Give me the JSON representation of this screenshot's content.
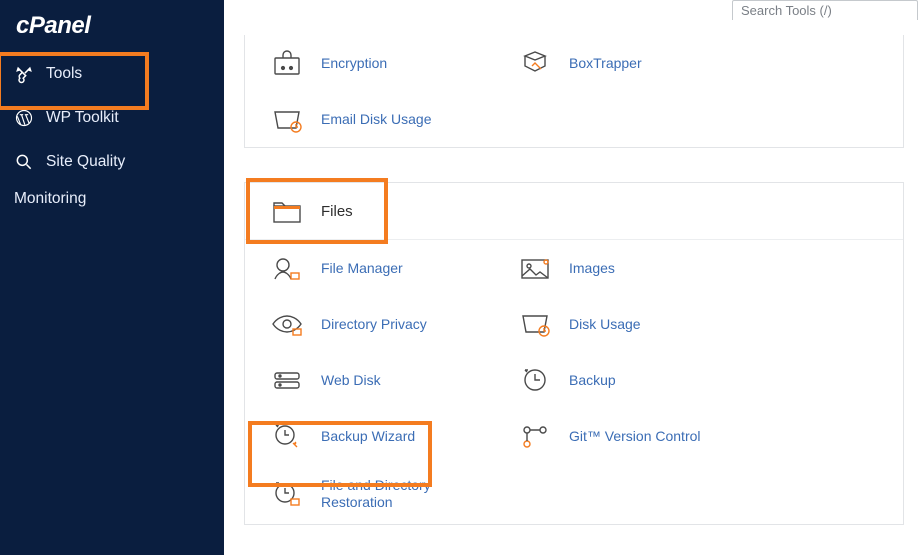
{
  "brand": {
    "name": "cPanel"
  },
  "search": {
    "placeholder": "Search Tools (/)"
  },
  "sidebar": {
    "items": [
      {
        "label": "Tools",
        "icon": "tools-icon"
      },
      {
        "label": "WP Toolkit",
        "icon": "wordpress-icon"
      },
      {
        "label": "Site Quality",
        "icon": "magnify-icon"
      },
      {
        "label": "Monitoring",
        "icon": ""
      }
    ]
  },
  "section_email": {
    "items": [
      {
        "label": "Encryption",
        "icon": "encryption-icon"
      },
      {
        "label": "BoxTrapper",
        "icon": "boxtrapper-icon"
      },
      {
        "label": "Email Disk Usage",
        "icon": "disk-clock-icon"
      }
    ]
  },
  "section_files": {
    "heading": "Files",
    "items": [
      {
        "label": "File Manager",
        "icon": "file-manager-icon"
      },
      {
        "label": "Images",
        "icon": "images-icon"
      },
      {
        "label": "Directory Privacy",
        "icon": "directory-privacy-icon"
      },
      {
        "label": "Disk Usage",
        "icon": "disk-usage-icon"
      },
      {
        "label": "Web Disk",
        "icon": "web-disk-icon"
      },
      {
        "label": "Backup",
        "icon": "backup-icon"
      },
      {
        "label": "Backup Wizard",
        "icon": "backup-wizard-icon"
      },
      {
        "label": "Git™ Version Control",
        "icon": "git-icon"
      },
      {
        "label": "File and Directory Restoration",
        "icon": "restore-icon"
      }
    ]
  },
  "highlights": {
    "tools": true,
    "files": true,
    "backup_wizard": true
  },
  "colors": {
    "accent": "#f47c20",
    "sidebar_bg": "#0a1e3f",
    "link": "#3b6db5"
  }
}
